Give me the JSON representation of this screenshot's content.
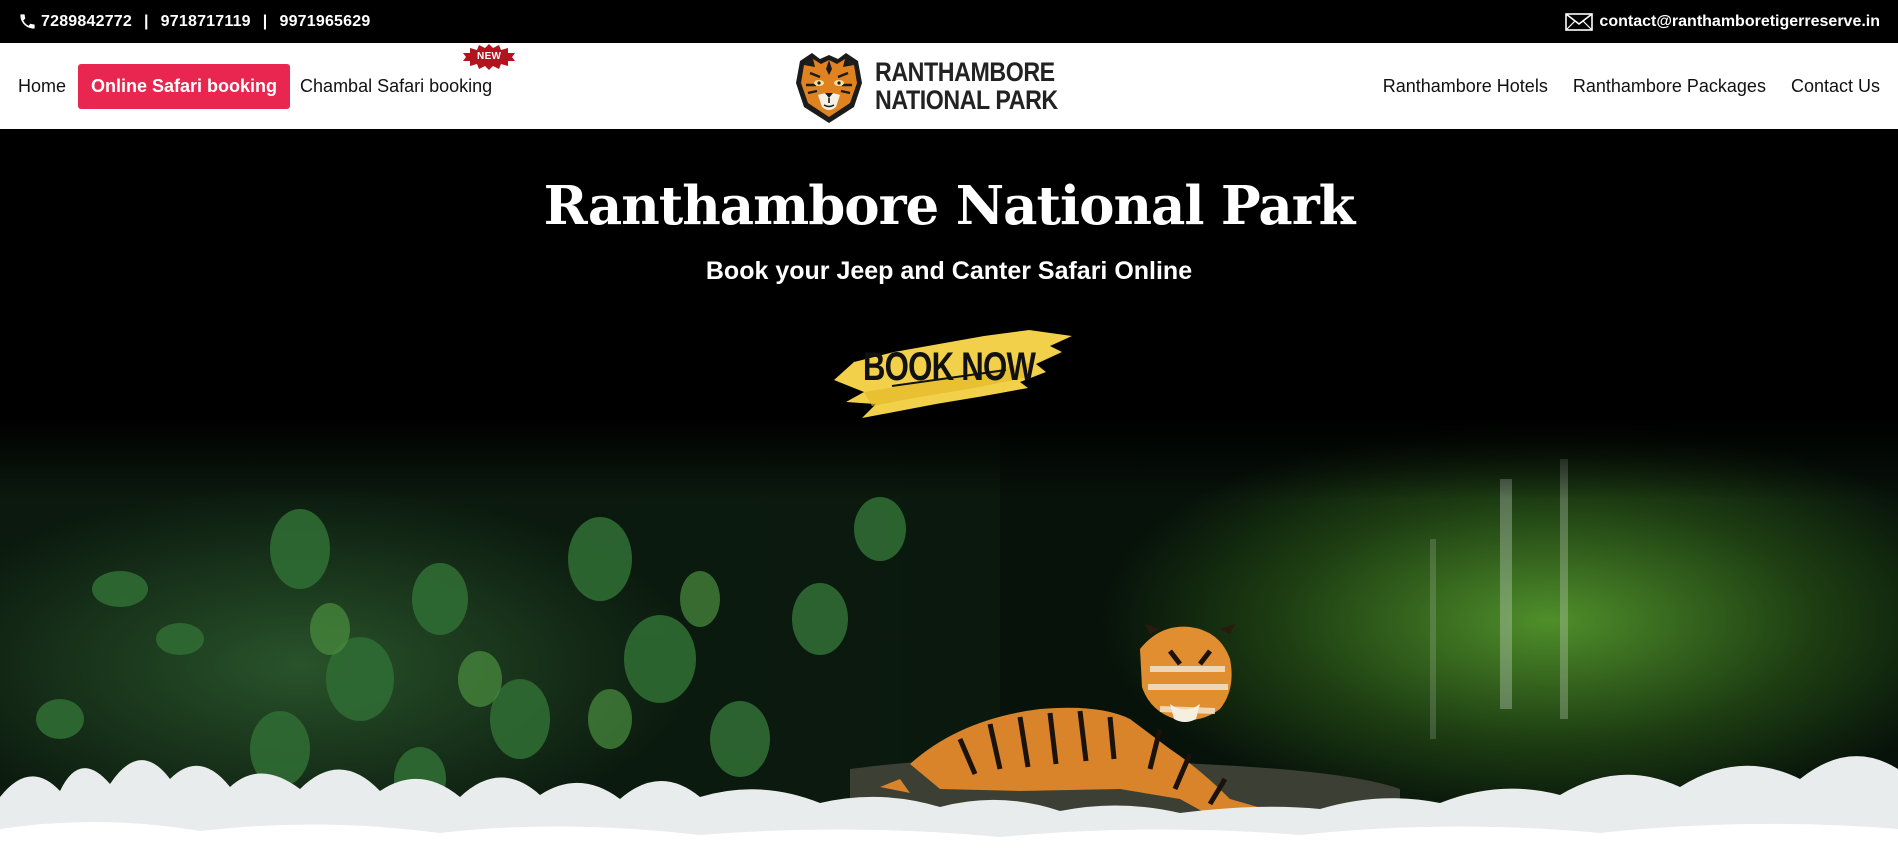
{
  "topbar": {
    "phones": [
      "7289842772",
      "9718717119",
      "9971965629"
    ],
    "separator": "|",
    "email": "contact@ranthamboretigerreserve.in"
  },
  "nav": {
    "left": [
      {
        "label": "Home"
      },
      {
        "label": "Online Safari booking",
        "highlight": true
      },
      {
        "label": "Chambal Safari booking",
        "badge": "NEW"
      }
    ],
    "right": [
      {
        "label": "Ranthambore Hotels"
      },
      {
        "label": "Ranthambore Packages"
      },
      {
        "label": "Contact Us"
      }
    ]
  },
  "logo": {
    "line1": "RANTHAMBORE",
    "line2": "NATIONAL PARK"
  },
  "hero": {
    "title": "Ranthambore National Park",
    "subtitle": "Book your Jeep and Canter Safari Online",
    "cta": "BOOK NOW"
  },
  "colors": {
    "accent": "#e8264f",
    "badge": "#b3121f",
    "cta_brush": "#f2d04a",
    "topbar_bg": "#000000"
  },
  "icons": {
    "phone": "phone-icon",
    "email": "mail-icon",
    "logo": "tiger-logo-icon"
  }
}
